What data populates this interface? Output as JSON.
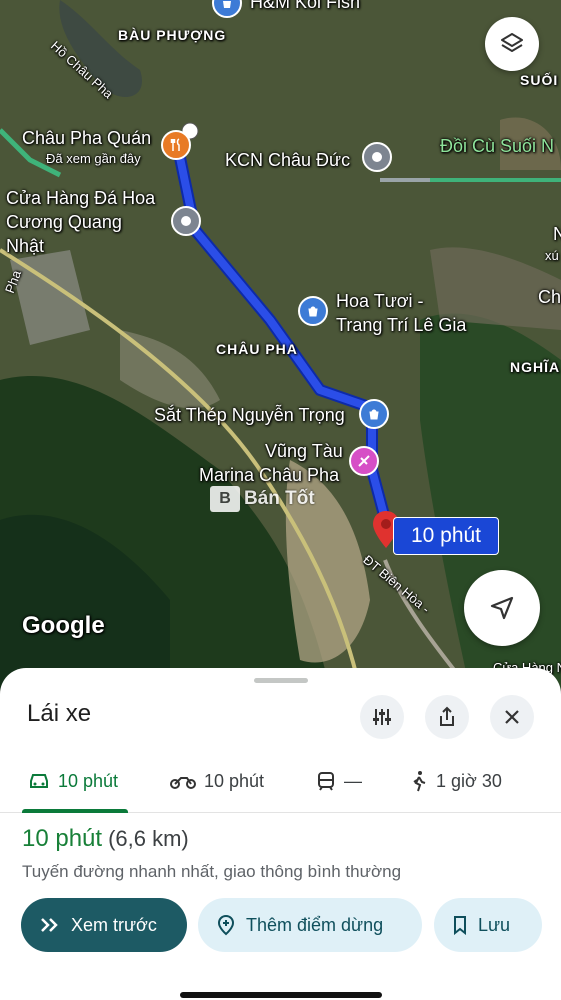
{
  "map": {
    "labels": {
      "hm_koi": "H&M Koi Fish",
      "bau_phuong": "BÀU PHƯỢNG",
      "ho_chau_pha": "Hồ Châu Pha",
      "suoi": "SUỐI",
      "chau_pha_quan": "Châu Pha Quán",
      "chau_pha_quan_sub": "Đã xem gần đây",
      "kcn": "KCN Châu Đức",
      "doi_cu": "Đồi Cù Suối N",
      "cua_hang_1": "Cửa Hàng Đá Hoa",
      "cua_hang_2": "Cương Quang",
      "cua_hang_3": "Nhật",
      "hoa_tuoi_1": "Hoa Tươi -",
      "hoa_tuoi_2": "Trang Trí Lê Gia",
      "chau_pha": "CHÂU PHA",
      "nghia": "NGHĨA T",
      "sat_thep": "Sắt Thép Nguyễn Trọng",
      "vung_tau": "Vũng Tàu",
      "marina": "Marina Châu Pha",
      "ch": "Ch",
      "n_edge": "N",
      "xu": "xú",
      "pha_edge": "Pha",
      "road": "ĐT Biên Hòa -",
      "google": "Google",
      "bottom_edge": "Cửa Hàng N",
      "watermark": "Bán Tốt"
    },
    "time_bubble": "10 phút",
    "route_color": "#2b4ee8"
  },
  "sheet": {
    "title": "Lái xe",
    "tabs": [
      {
        "icon": "car-icon",
        "label": "10 phút"
      },
      {
        "icon": "motorbike-icon",
        "label": "10 phút"
      },
      {
        "icon": "transit-icon",
        "label": "—"
      },
      {
        "icon": "walk-icon",
        "label": "1 giờ 30"
      }
    ],
    "summary_time": "10 phút",
    "summary_distance": "(6,6 km)",
    "description": "Tuyến đường nhanh nhất, giao thông bình thường",
    "buttons": {
      "preview": "Xem trước",
      "add_stop": "Thêm điểm dừng",
      "save": "Lưu"
    }
  }
}
